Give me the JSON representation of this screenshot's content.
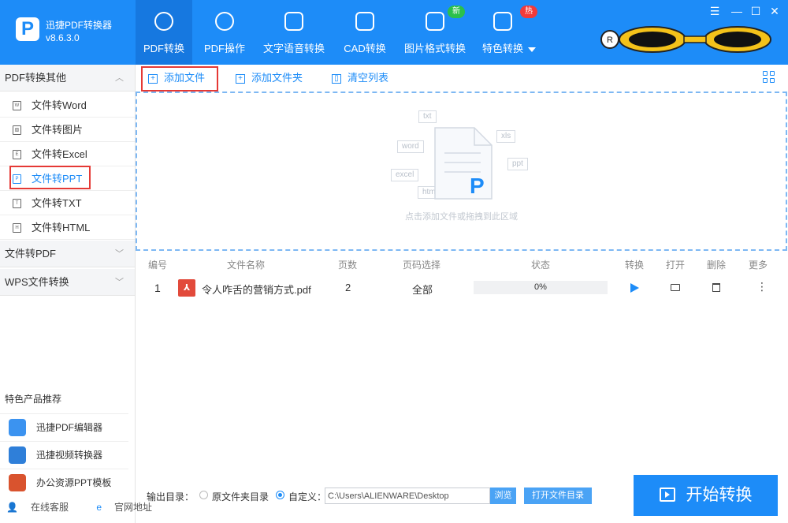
{
  "app": {
    "name": "迅捷PDF转换器",
    "version": "v8.6.3.0",
    "logo_letter": "P"
  },
  "tabs": [
    {
      "label": "PDF转换",
      "icon": "convert-icon",
      "active": true
    },
    {
      "label": "PDF操作",
      "icon": "settings-icon"
    },
    {
      "label": "文字语音转换",
      "icon": "audio-wave-icon"
    },
    {
      "label": "CAD转换",
      "icon": "cad-icon"
    },
    {
      "label": "图片格式转换",
      "icon": "image-icon",
      "badge": "新"
    },
    {
      "label": "特色转换",
      "icon": "star-icon",
      "badge": "热",
      "dropdown": true
    }
  ],
  "window_controls": {
    "menu": "☰",
    "minimize": "—",
    "maximize": "☐",
    "close": "✕"
  },
  "sidebar": {
    "groups": [
      {
        "label": "PDF转换其他",
        "expanded": true,
        "chevron": "︿"
      },
      {
        "label": "文件转PDF",
        "expanded": false,
        "chevron": "﹀"
      },
      {
        "label": "WPS文件转换",
        "expanded": false,
        "chevron": "﹀"
      }
    ],
    "items": [
      {
        "label": "文件转Word",
        "icon_letter": "W"
      },
      {
        "label": "文件转图片",
        "icon_letter": "▧"
      },
      {
        "label": "文件转Excel",
        "icon_letter": "E"
      },
      {
        "label": "文件转PPT",
        "icon_letter": "P",
        "selected": true
      },
      {
        "label": "文件转TXT",
        "icon_letter": "T"
      },
      {
        "label": "文件转HTML",
        "icon_letter": "H"
      }
    ],
    "promo_title": "特色产品推荐",
    "promos": [
      {
        "label": "迅捷PDF编辑器",
        "color": "#3b93f0"
      },
      {
        "label": "迅捷视频转换器",
        "color": "#2f7fd9"
      },
      {
        "label": "办公资源PPT模板",
        "color": "#d9532e"
      }
    ],
    "bottom_links": [
      {
        "label": "在线客服",
        "icon": "👤"
      },
      {
        "label": "官网地址",
        "icon": "e"
      }
    ]
  },
  "toolbar": {
    "add_file": "添加文件",
    "add_folder": "添加文件夹",
    "clear_list": "清空列表"
  },
  "dropzone": {
    "hint": "点击添加文件或拖拽到此区域",
    "tags": [
      "txt",
      "xls",
      "word",
      "ppt",
      "excel",
      "html"
    ],
    "logo_letter": "P"
  },
  "table": {
    "headers": [
      "编号",
      "文件名称",
      "页数",
      "页码选择",
      "状态",
      "转换",
      "打开",
      "删除",
      "更多"
    ],
    "rows": [
      {
        "index": "1",
        "name": "令人咋舌的营销方式.pdf",
        "pages": "2",
        "range": "全部",
        "progress": 0,
        "progress_text": "0%",
        "more": "⋮"
      }
    ]
  },
  "output": {
    "label": "输出目录：",
    "option_original": "原文件夹目录",
    "option_custom": "自定义：",
    "selected": "custom",
    "path": "C:\\Users\\ALIENWARE\\Desktop",
    "browse": "浏览",
    "open_dir": "打开文件目录"
  },
  "start_button": "开始转换",
  "colors": {
    "primary": "#1d8cf8",
    "highlight_border": "#e53935",
    "badge_new": "#2bc04b",
    "badge_hot": "#f23a3a"
  }
}
